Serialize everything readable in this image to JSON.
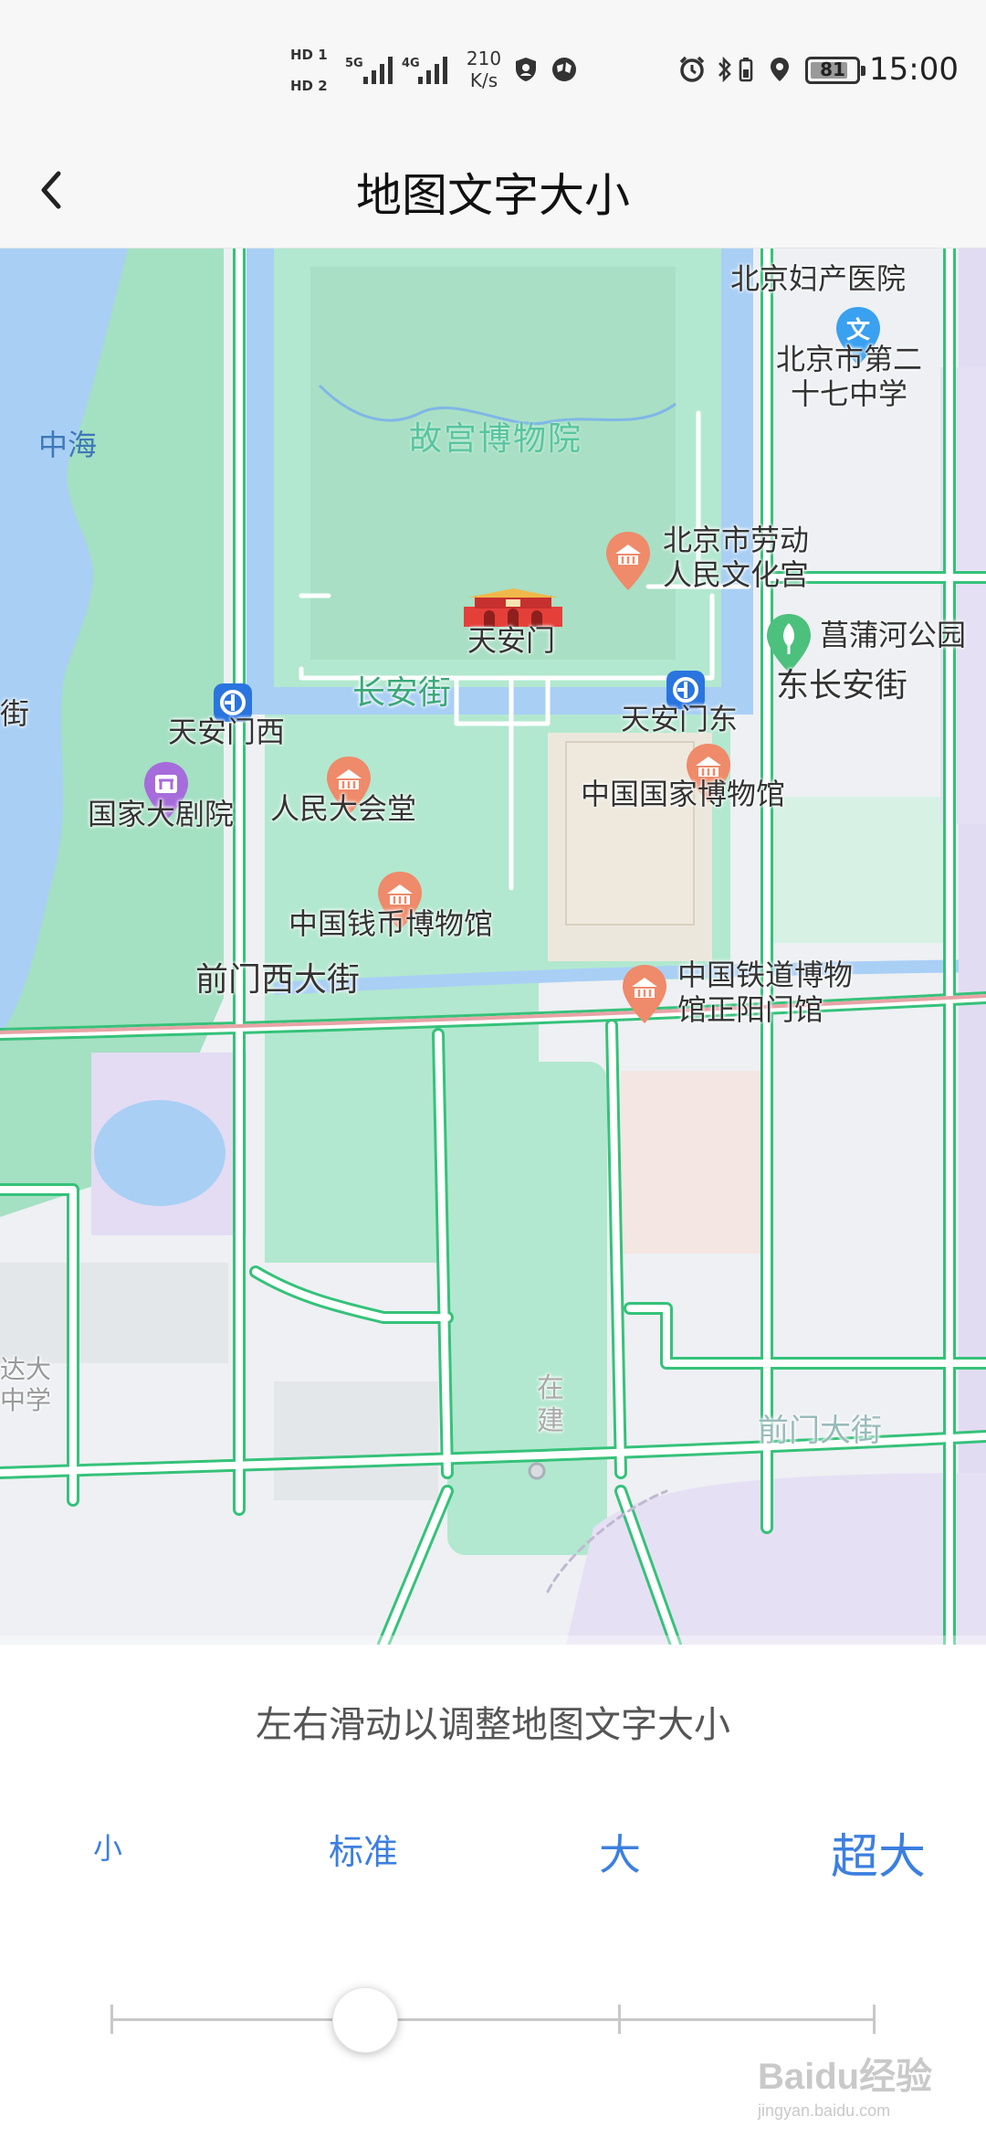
{
  "status_bar": {
    "hd1": "HD 1",
    "hd2": "HD 2",
    "sig1": "5G",
    "sig2": "4G",
    "speed_value": "210",
    "speed_unit": "K/s",
    "battery": "81",
    "time": "15:00"
  },
  "header": {
    "title": "地图文字大小"
  },
  "map": {
    "labels": {
      "zhonghai": "中海",
      "fuchan": "北京妇产医院",
      "school_line1": "北京市第二",
      "school_line2": "十七中学",
      "gugong": "故宫博物院",
      "laodong_line1": "北京市劳动",
      "laodong_line2": "人民文化宫",
      "tiananmen": "天安门",
      "changpu": "菖蒲河公园",
      "changan_left": "街",
      "changan": "长安街",
      "dongchangan": "东长安街",
      "tam_west": "天安门西",
      "tam_east": "天安门东",
      "theatre": "国家大剧院",
      "great_hall": "人民大会堂",
      "museum": "中国国家博物馆",
      "coin_museum": "中国钱币博物馆",
      "qianmen_west": "前门西大街",
      "railway_line1": "中国铁道博物",
      "railway_line2": "馆正阳门馆",
      "faded_left1": "达大",
      "faded_left2": "中学",
      "faded_center": "在建",
      "faded_right": "前门大街"
    }
  },
  "panel": {
    "hint": "左右滑动以调整地图文字大小",
    "options": [
      "小",
      "标准",
      "大",
      "超大"
    ],
    "selected": "标准"
  },
  "watermark": {
    "brand": "Baidu经验",
    "url": "jingyan.baidu.com"
  },
  "colors": {
    "accent": "#3c7fe0",
    "road": "#35c27a",
    "water": "#a9cff5",
    "park": "#b2e8cf"
  }
}
